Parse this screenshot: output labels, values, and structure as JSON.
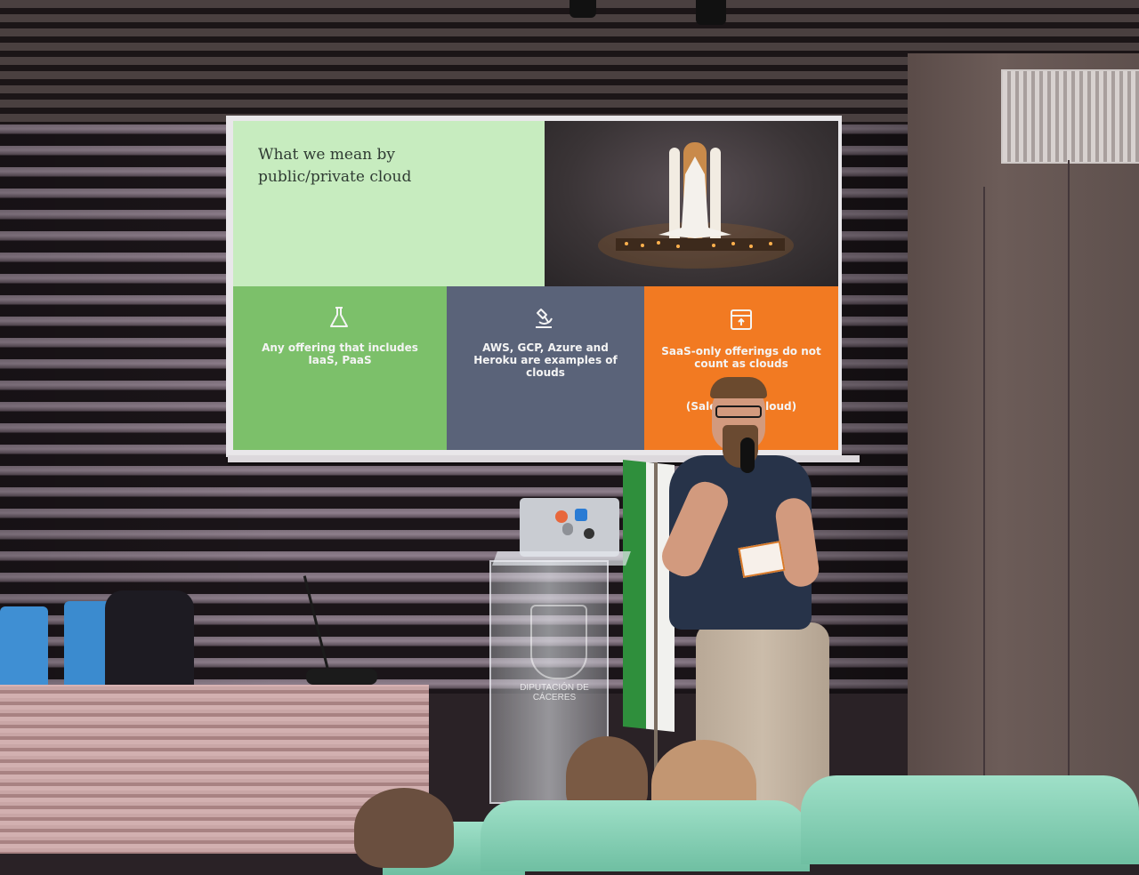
{
  "slide": {
    "title": "What we mean by\npublic/private cloud",
    "tiles": [
      {
        "icon": "flask-icon",
        "text": "Any offering that includes IaaS, PaaS",
        "color": "#7cc06a"
      },
      {
        "icon": "microscope-icon",
        "text": "AWS, GCP, Azure and Heroku are examples of clouds",
        "color": "#5a6379"
      },
      {
        "icon": "archive-box-icon",
        "text": "SaaS-only offerings do not count as clouds",
        "subtext": "(Sales… …a cloud)",
        "color": "#f27a22"
      }
    ],
    "photo": "space-shuttle-launch-pad"
  },
  "podium": {
    "caption": "DIPUTACIÓN DE CÁCERES"
  },
  "colors": {
    "slide_green": "#c7ecbf",
    "slide_orange": "#f27a22",
    "slide_slate": "#5a6379"
  }
}
